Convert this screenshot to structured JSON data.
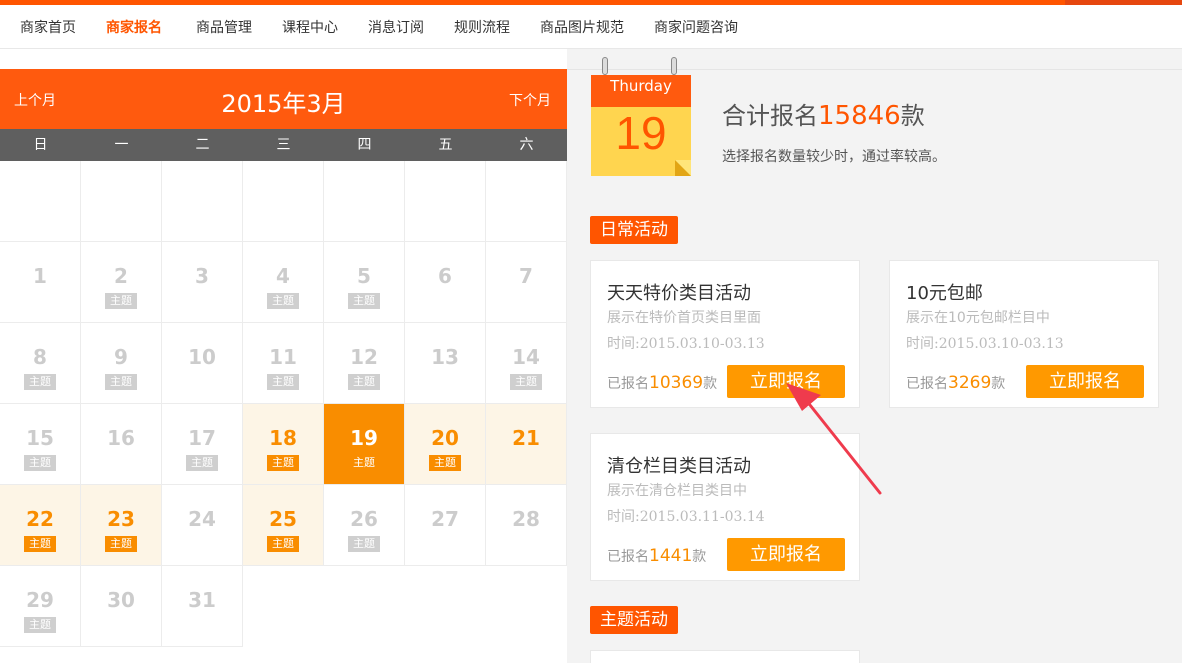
{
  "nav": {
    "items": [
      {
        "label": "商家首页",
        "active": false
      },
      {
        "label": "商家报名",
        "active": true
      },
      {
        "label": "商品管理",
        "active": false
      },
      {
        "label": "课程中心",
        "active": false
      },
      {
        "label": "消息订阅",
        "active": false
      },
      {
        "label": "规则流程",
        "active": false
      },
      {
        "label": "商品图片规范",
        "active": false
      },
      {
        "label": "商家问题咨询",
        "active": false
      }
    ]
  },
  "calendar": {
    "prev_label": "上个月",
    "next_label": "下个月",
    "title": "2015年3月",
    "weekdays": [
      "日",
      "一",
      "二",
      "三",
      "四",
      "五",
      "六"
    ],
    "badge_label": "主题",
    "days": [
      {
        "day": "1",
        "badge": false,
        "state": "normal"
      },
      {
        "day": "2",
        "badge": true,
        "state": "normal"
      },
      {
        "day": "3",
        "badge": false,
        "state": "normal"
      },
      {
        "day": "4",
        "badge": true,
        "state": "normal"
      },
      {
        "day": "5",
        "badge": true,
        "state": "normal"
      },
      {
        "day": "6",
        "badge": false,
        "state": "normal"
      },
      {
        "day": "7",
        "badge": false,
        "state": "normal"
      },
      {
        "day": "8",
        "badge": true,
        "state": "normal"
      },
      {
        "day": "9",
        "badge": true,
        "state": "normal"
      },
      {
        "day": "10",
        "badge": false,
        "state": "normal"
      },
      {
        "day": "11",
        "badge": true,
        "state": "normal"
      },
      {
        "day": "12",
        "badge": true,
        "state": "normal"
      },
      {
        "day": "13",
        "badge": false,
        "state": "normal"
      },
      {
        "day": "14",
        "badge": true,
        "state": "normal"
      },
      {
        "day": "15",
        "badge": true,
        "state": "normal"
      },
      {
        "day": "16",
        "badge": false,
        "state": "normal"
      },
      {
        "day": "17",
        "badge": true,
        "state": "normal"
      },
      {
        "day": "18",
        "badge": true,
        "state": "highlight"
      },
      {
        "day": "19",
        "badge": true,
        "state": "today"
      },
      {
        "day": "20",
        "badge": true,
        "state": "highlight"
      },
      {
        "day": "21",
        "badge": false,
        "state": "highlight"
      },
      {
        "day": "22",
        "badge": true,
        "state": "highlight"
      },
      {
        "day": "23",
        "badge": true,
        "state": "highlight"
      },
      {
        "day": "24",
        "badge": false,
        "state": "normal"
      },
      {
        "day": "25",
        "badge": true,
        "state": "highlight"
      },
      {
        "day": "26",
        "badge": true,
        "state": "normal"
      },
      {
        "day": "27",
        "badge": false,
        "state": "normal"
      },
      {
        "day": "28",
        "badge": false,
        "state": "normal"
      },
      {
        "day": "29",
        "badge": true,
        "state": "normal"
      },
      {
        "day": "30",
        "badge": false,
        "state": "normal"
      },
      {
        "day": "31",
        "badge": false,
        "state": "normal"
      }
    ]
  },
  "date_icon": {
    "weekday": "Thurday",
    "day": "19"
  },
  "summary": {
    "prefix": "合计报名",
    "count": "15846",
    "suffix": "款",
    "hint": "选择报名数量较少时，通过率较高。"
  },
  "sections": {
    "daily": "日常活动",
    "theme": "主题活动"
  },
  "activities": [
    {
      "title": "天天特价类目活动",
      "desc": "展示在特价首页类目里面",
      "time": "时间:2015.03.10-03.13",
      "count_prefix": "已报名",
      "count": "10369",
      "count_suffix": "款",
      "button": "立即报名"
    },
    {
      "title": "10元包邮",
      "desc": "展示在10元包邮栏目中",
      "time": "时间:2015.03.10-03.13",
      "count_prefix": "已报名",
      "count": "3269",
      "count_suffix": "款",
      "button": "立即报名"
    },
    {
      "title": "清仓栏目类目活动",
      "desc": "展示在清仓栏目类目中",
      "time": "时间:2015.03.11-03.14",
      "count_prefix": "已报名",
      "count": "1441",
      "count_suffix": "款",
      "button": "立即报名"
    }
  ],
  "colors": {
    "brand": "#ff5500",
    "accent": "#ff9900",
    "highlight_bg": "#fdf5e6"
  }
}
